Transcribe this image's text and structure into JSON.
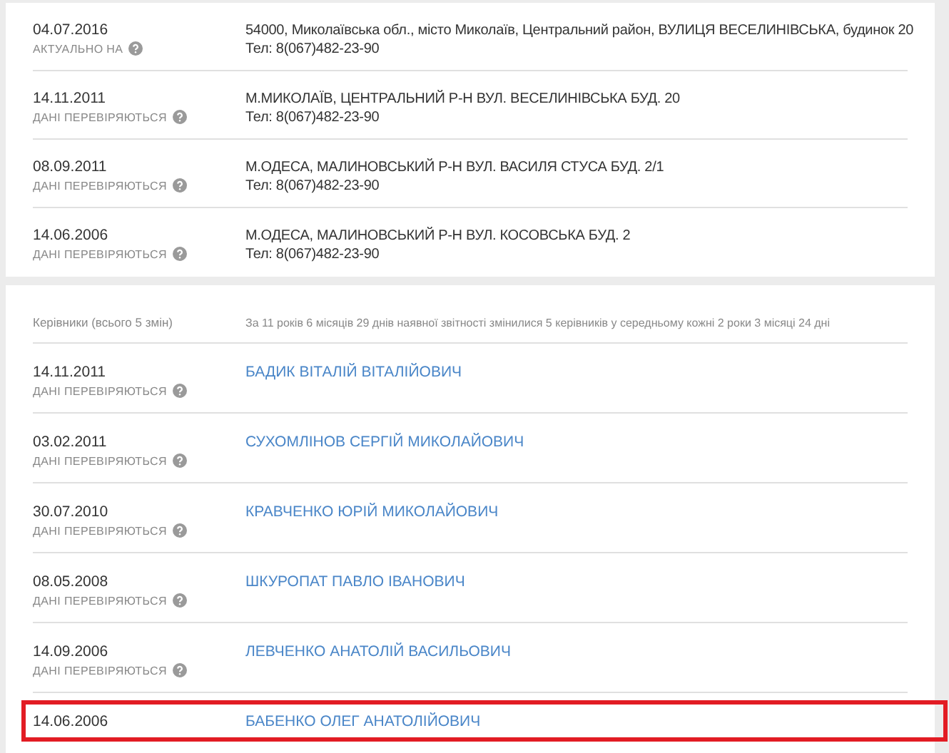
{
  "addresses": [
    {
      "date": "04.07.2016",
      "status": "АКТУАЛЬНО НА",
      "address": "54000, Миколаївська обл., місто Миколаїв, Центральний район, ВУЛИЦЯ ВЕСЕЛИНІВСЬКА, будинок 20",
      "phone": "Тел: 8(067)482-23-90"
    },
    {
      "date": "14.11.2011",
      "status": "ДАНІ ПЕРЕВІРЯЮТЬСЯ",
      "address": "М.МИКОЛАЇВ, ЦЕНТРАЛЬНИЙ Р-Н ВУЛ. ВЕСЕЛИНІВСЬКА БУД. 20",
      "phone": "Тел: 8(067)482-23-90"
    },
    {
      "date": "08.09.2011",
      "status": "ДАНІ ПЕРЕВІРЯЮТЬСЯ",
      "address": "М.ОДЕСА, МАЛИНОВСЬКИЙ Р-Н ВУЛ. ВАСИЛЯ СТУСА БУД. 2/1",
      "phone": "Тел: 8(067)482-23-90"
    },
    {
      "date": "14.06.2006",
      "status": "ДАНІ ПЕРЕВІРЯЮТЬСЯ",
      "address": "М.ОДЕСА, МАЛИНОВСЬКИЙ Р-Н ВУЛ. КОСОВСЬКА БУД. 2",
      "phone": "Тел: 8(067)482-23-90"
    }
  ],
  "directors": {
    "title": "Керівники (всього 5 змін)",
    "summary": "За 11 років 6 місяців 29 днів наявної звітності змінилися 5 керівників у середньому кожні 2 роки 3 місяці 24 дні",
    "rows": [
      {
        "date": "14.11.2011",
        "status": "ДАНІ ПЕРЕВІРЯЮТЬСЯ",
        "name": "БАДИК ВІТАЛІЙ ВІТАЛІЙОВИЧ",
        "highlighted": false
      },
      {
        "date": "03.02.2011",
        "status": "ДАНІ ПЕРЕВІРЯЮТЬСЯ",
        "name": "СУХОМЛІНОВ СЕРГІЙ МИКОЛАЙОВИЧ",
        "highlighted": false
      },
      {
        "date": "30.07.2010",
        "status": "ДАНІ ПЕРЕВІРЯЮТЬСЯ",
        "name": "КРАВЧЕНКО ЮРІЙ МИКОЛАЙОВИЧ",
        "highlighted": false
      },
      {
        "date": "08.05.2008",
        "status": "ДАНІ ПЕРЕВІРЯЮТЬСЯ",
        "name": "ШКУРОПАТ ПАВЛО ІВАНОВИЧ",
        "highlighted": false
      },
      {
        "date": "14.09.2006",
        "status": "ДАНІ ПЕРЕВІРЯЮТЬСЯ",
        "name": "ЛЕВЧЕНКО АНАТОЛІЙ ВАСИЛЬОВИЧ",
        "highlighted": false
      },
      {
        "date": "14.06.2006",
        "name": "БАБЕНКО ОЛЕГ АНАТОЛІЙОВИЧ",
        "highlighted": true
      }
    ]
  }
}
